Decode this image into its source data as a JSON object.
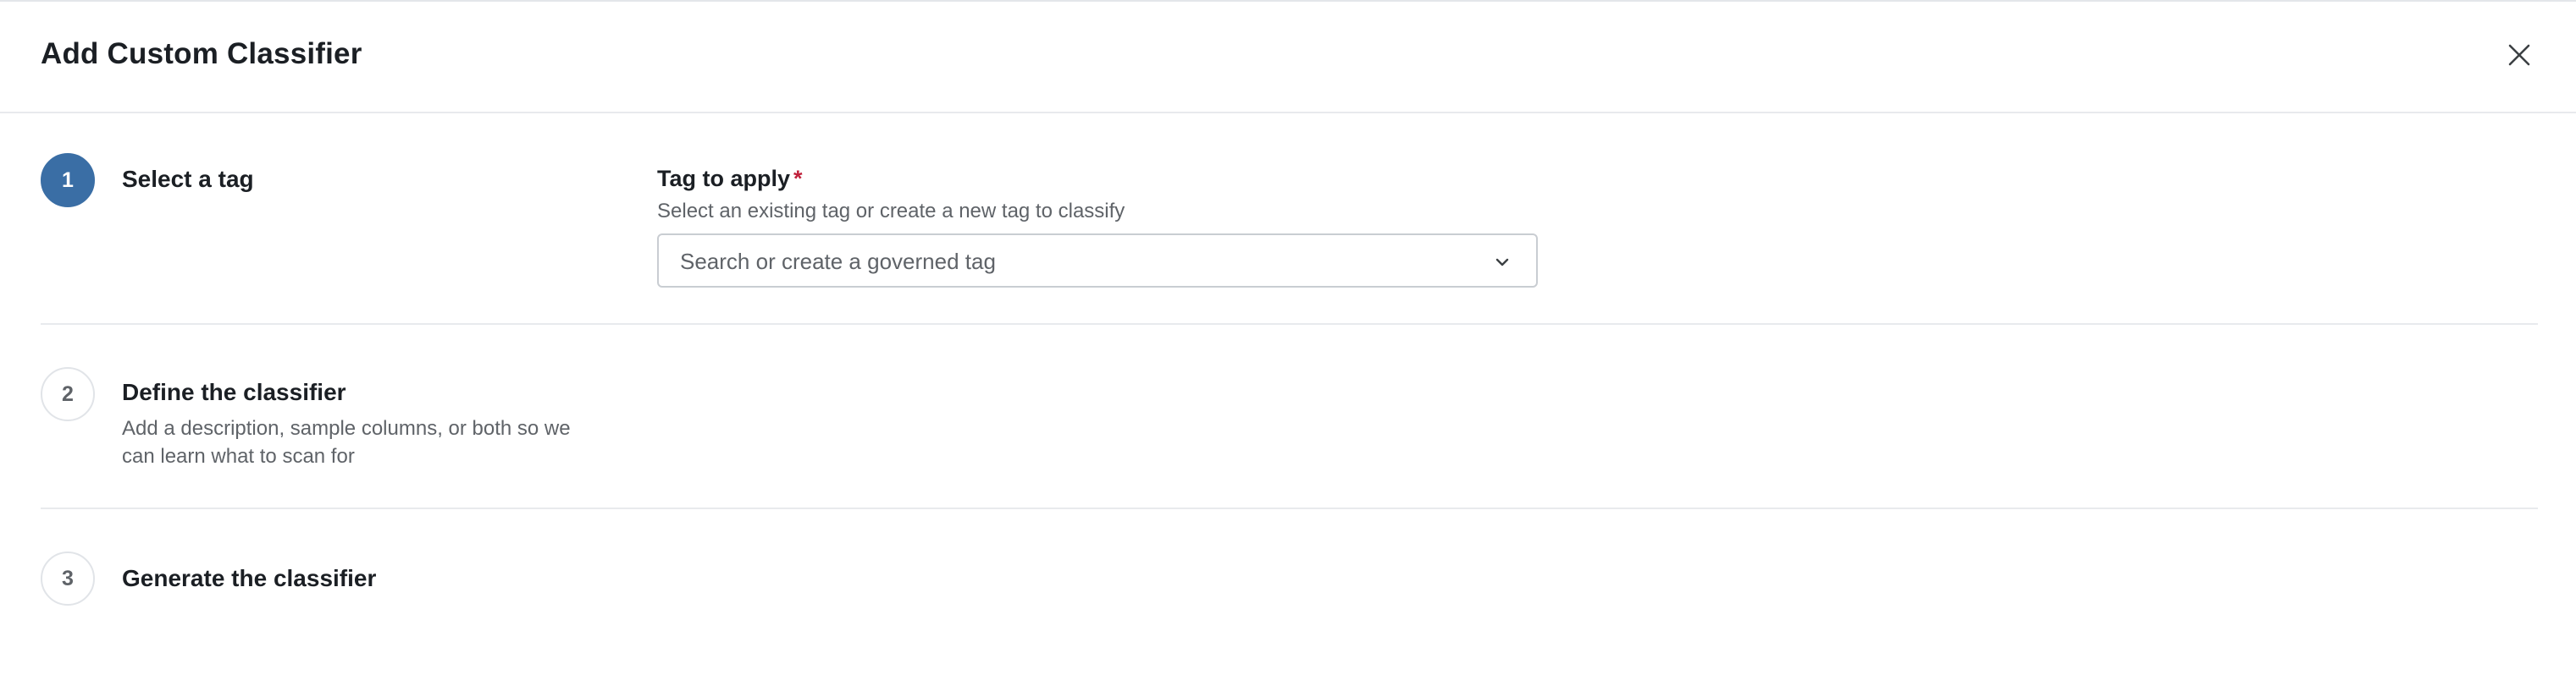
{
  "dialog": {
    "title": "Add Custom Classifier",
    "close_icon": "close-icon"
  },
  "steps": [
    {
      "number": "1",
      "title": "Select a tag",
      "state": "active"
    },
    {
      "number": "2",
      "title": "Define the classifier",
      "description": "Add a description, sample columns, or both so we can learn what to scan for",
      "state": "inactive"
    },
    {
      "number": "3",
      "title": "Generate the classifier",
      "state": "inactive"
    }
  ],
  "tag_field": {
    "label": "Tag to apply",
    "required_mark": "*",
    "help_text": "Select an existing tag or create a new tag to classify",
    "placeholder": "Search or create a governed tag",
    "value": "",
    "dropdown_icon": "chevron-down-icon"
  },
  "colors": {
    "accent": "#3a6ea5",
    "required": "#c0213b",
    "divider": "#e8eaed",
    "muted_text": "#5f6368"
  }
}
